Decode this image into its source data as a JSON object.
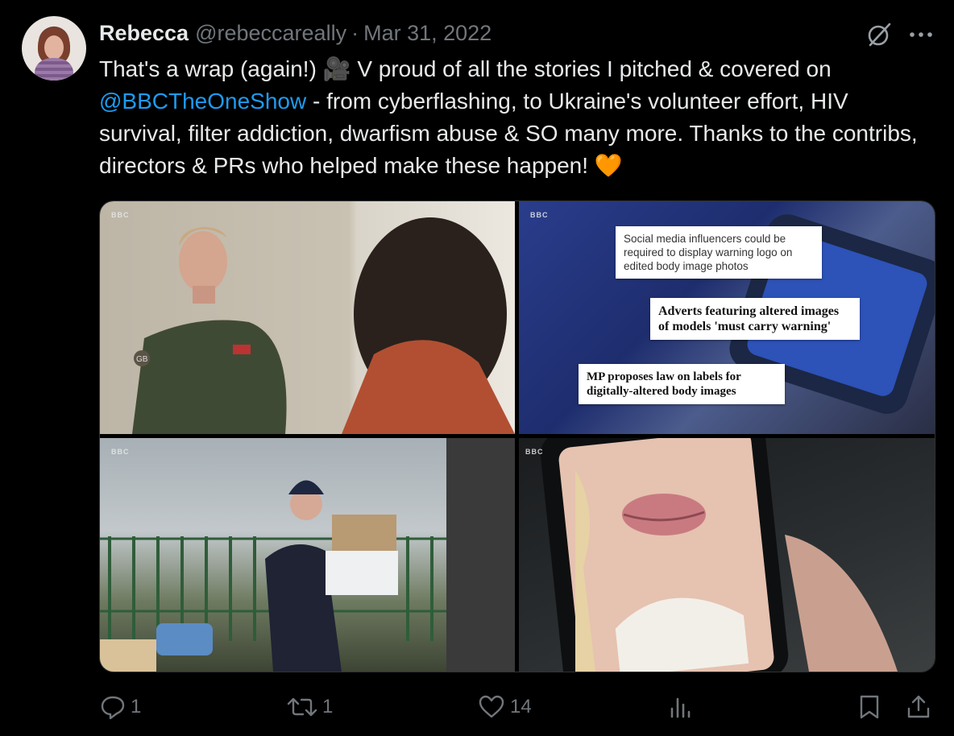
{
  "tweet": {
    "author_name": "Rebecca",
    "handle": "@rebeccareally",
    "separator": "·",
    "date": "Mar 31, 2022",
    "text_part1": "That's a wrap (again!) 🎥 V proud of all the stories I pitched & covered on ",
    "mention": "@BBCTheOneShow",
    "text_part2": " - from cyberflashing, to Ukraine's volunteer effort, HIV survival, filter addiction, dwarfism abuse & SO many more. Thanks to the contribs, directors & PRs who helped make these happen! 🧡"
  },
  "media": {
    "watermark": "BBC",
    "panel2_captions": [
      "Social media influencers could be required to display warning logo on edited body image photos",
      "Adverts featuring altered images of models 'must carry warning'",
      "MP proposes law on labels for digitally-altered body images"
    ],
    "patch_text": "GB"
  },
  "actions": {
    "replies": "1",
    "retweets": "1",
    "likes": "14"
  },
  "icons": {
    "top": [
      "grok-icon",
      "more-icon"
    ],
    "bottom": [
      "reply-icon",
      "retweet-icon",
      "like-icon",
      "views-icon",
      "bookmark-icon",
      "share-icon"
    ]
  },
  "colors": {
    "link": "#1d9bf0",
    "muted": "#71767b",
    "text": "#e7e9ea",
    "background": "#000000"
  }
}
